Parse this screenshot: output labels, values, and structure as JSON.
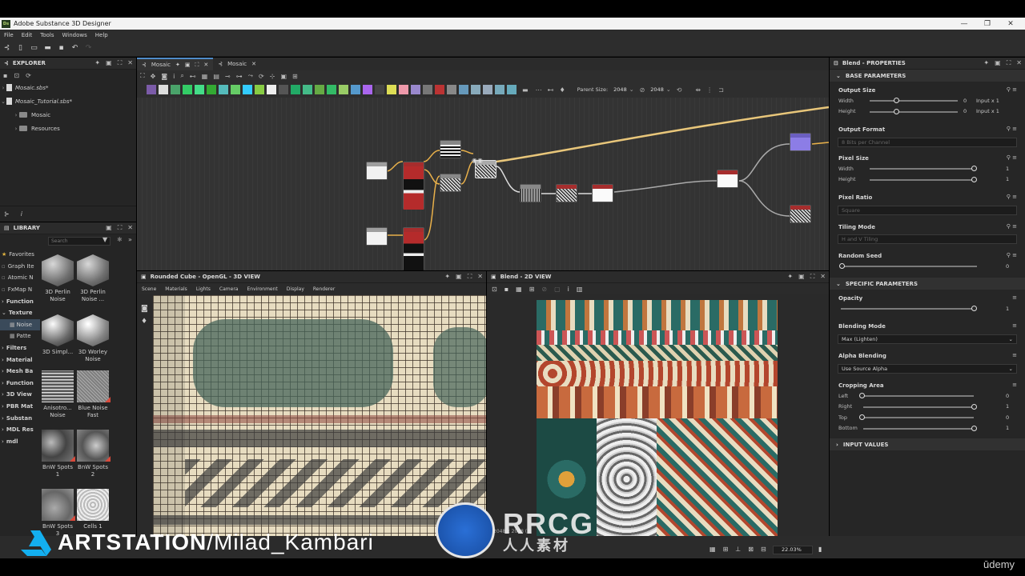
{
  "app": {
    "title": "Adobe Substance 3D Designer",
    "logo": "Ds"
  },
  "menu": [
    "File",
    "Edit",
    "Tools",
    "Windows",
    "Help"
  ],
  "explorer": {
    "title": "EXPLORER",
    "items": [
      {
        "label": "Mosaic.sbs*"
      },
      {
        "label": "Mosaic_Tutorial.sbs*"
      },
      {
        "label": "Mosaic"
      },
      {
        "label": "Resources"
      }
    ]
  },
  "library": {
    "title": "LIBRARY",
    "search_placeholder": "Search",
    "categories": [
      "Favorites",
      "Graph Ite",
      "Atomic N",
      "FxMap N",
      "Function",
      "Texture",
      "Noise",
      "Patte",
      "Filters",
      "Material",
      "Mesh Ba",
      "Function",
      "3D View",
      "PBR Mat",
      "Substan",
      "MDL Res",
      "mdl"
    ],
    "thumbnails": [
      {
        "label": "3D Perlin Noise"
      },
      {
        "label": "3D Perlin Noise ..."
      },
      {
        "label": "3D Simpl..."
      },
      {
        "label": "3D Worley Noise"
      },
      {
        "label": "Anisotro... Noise"
      },
      {
        "label": "Blue Noise Fast"
      },
      {
        "label": "BnW Spots 1"
      },
      {
        "label": "BnW Spots 2"
      },
      {
        "label": "BnW Spots 3"
      },
      {
        "label": "Cells 1"
      }
    ]
  },
  "graph": {
    "tabs": [
      {
        "label": "Mosaic"
      },
      {
        "label": "Mosaic"
      }
    ],
    "parent_size_label": "Parent Size:",
    "parent_size_value": "2048",
    "size_value": "2048"
  },
  "view3d": {
    "title": "Rounded Cube - OpenGL - 3D VIEW",
    "menu": [
      "Scene",
      "Materials",
      "Lights",
      "Camera",
      "Environment",
      "Display",
      "Renderer"
    ]
  },
  "view2d": {
    "title": "Blend - 2D VIEW",
    "info": "2048 x 2048 (R",
    "zoom": "22.03%"
  },
  "properties": {
    "title": "Blend - PROPERTIES",
    "base_section": "BASE PARAMETERS",
    "output_size": {
      "label": "Output Size",
      "width_label": "Width",
      "width_value": "0",
      "width_mode": "Input x 1",
      "height_label": "Height",
      "height_value": "0",
      "height_mode": "Input x 1"
    },
    "output_format": {
      "label": "Output Format",
      "value": "8 Bits per Channel"
    },
    "pixel_size": {
      "label": "Pixel Size",
      "width_label": "Width",
      "width_value": "1",
      "height_label": "Height",
      "height_value": "1"
    },
    "pixel_ratio": {
      "label": "Pixel Ratio",
      "value": "Square"
    },
    "tiling_mode": {
      "label": "Tiling Mode",
      "value": "H and V Tiling"
    },
    "random_seed": {
      "label": "Random Seed",
      "value": "0"
    },
    "specific_section": "SPECIFIC PARAMETERS",
    "opacity": {
      "label": "Opacity",
      "value": "1"
    },
    "blending_mode": {
      "label": "Blending Mode",
      "value": "Max (Lighten)"
    },
    "alpha_blending": {
      "label": "Alpha Blending",
      "value": "Use Source Alpha"
    },
    "cropping": {
      "label": "Cropping Area",
      "left_label": "Left",
      "left_value": "0",
      "right_label": "Right",
      "right_value": "1",
      "top_label": "Top",
      "top_value": "0",
      "bottom_label": "Bottom",
      "bottom_value": "1"
    },
    "input_section": "INPUT VALUES"
  },
  "watermarks": {
    "artstation": "ARTSTATION",
    "handle": "/Milad_Kambari",
    "rrcg": "RRCG",
    "rrcg_cn": "人人素材",
    "udemy": "ūdemy"
  }
}
